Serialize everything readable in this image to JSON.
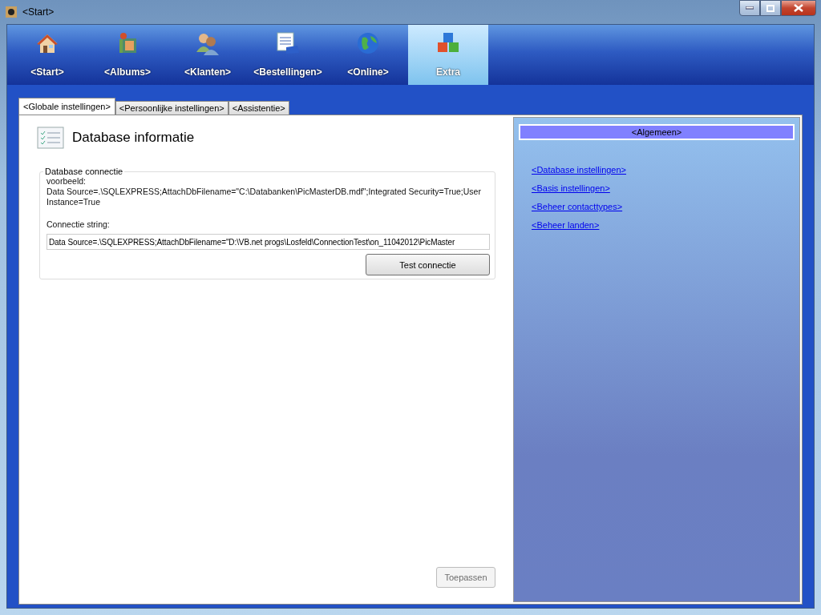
{
  "window": {
    "title": "<Start>"
  },
  "nav": [
    {
      "label": "<Start>",
      "selected": false
    },
    {
      "label": "<Albums>",
      "selected": false
    },
    {
      "label": "<Klanten>",
      "selected": false
    },
    {
      "label": "<Bestellingen>",
      "selected": false
    },
    {
      "label": "<Online>",
      "selected": false
    },
    {
      "label": "Extra",
      "selected": true
    }
  ],
  "tabs": [
    {
      "label": "<Globale instellingen>",
      "selected": true
    },
    {
      "label": "<Persoonlijke instellingen>",
      "selected": false
    },
    {
      "label": "<Assistentie>",
      "selected": false
    }
  ],
  "section": {
    "title": "Database informatie"
  },
  "group": {
    "legend": "Database connectie",
    "example_label": "voorbeeld:",
    "example": "Data Source=.\\SQLEXPRESS;AttachDbFilename=\"C:\\Databanken\\PicMasterDB.mdf\";Integrated Security=True;User Instance=True",
    "field_label": "Connectie string:",
    "field_value": "Data Source=.\\SQLEXPRESS;AttachDbFilename=\"D:\\VB.net progs\\Losfeld\\ConnectionTest\\on_11042012\\PicMaster",
    "test_button": "Test connectie"
  },
  "apply_button": {
    "label": "Toepassen",
    "disabled": true
  },
  "side": {
    "header": "<Algemeen>",
    "links": [
      "<Database instellingen>",
      "<Basis instellingen>",
      "<Beheer contacttypes>",
      "<Beheer landen>"
    ]
  }
}
